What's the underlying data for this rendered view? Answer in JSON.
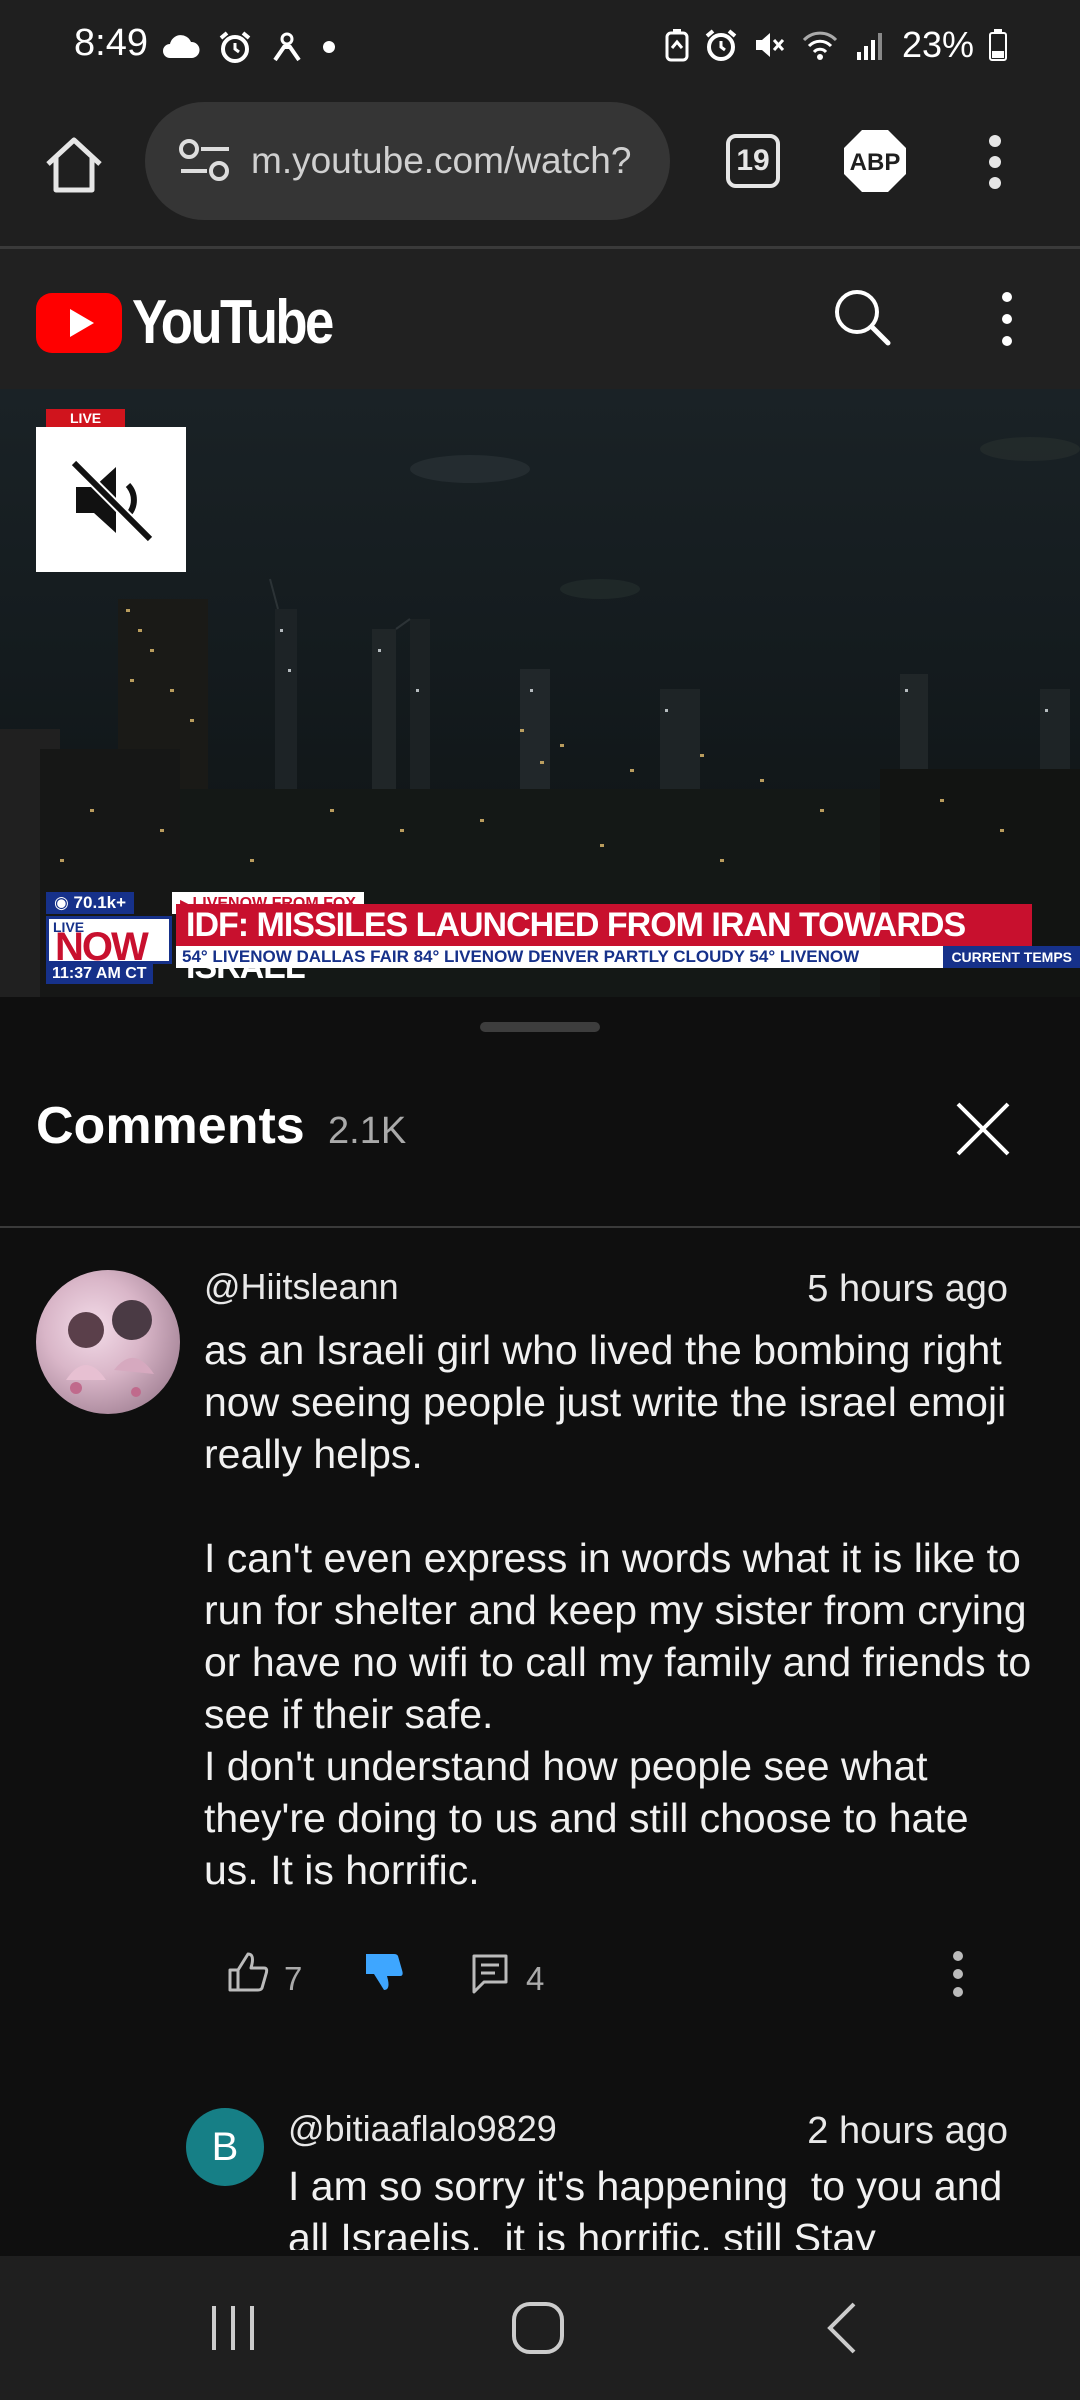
{
  "status_bar": {
    "time": "8:49",
    "battery": "23%"
  },
  "browser": {
    "url": "m.youtube.com/watch?",
    "tab_count": "19",
    "adblock_label": "ABP"
  },
  "youtube": {
    "logo_text": "YouTube"
  },
  "video": {
    "live_tag": "LIVE",
    "viewer_count": "◉ 70.1k+",
    "network": "▸ LIVENOW FROM FOX",
    "now_live": "LIVE",
    "now_word": "NOW",
    "headline": "IDF: MISSILES LAUNCHED FROM IRAN TOWARDS ISRAEL",
    "ticker": "54°   LIVENOW   DALLAS   FAIR  84°   LIVENOW   DENVER   PARTLY CLOUDY  54°   LIVENOW",
    "ticker_time": "11:37 AM CT",
    "current_temps": "CURRENT TEMPS"
  },
  "comments": {
    "title": "Comments",
    "count": "2.1K",
    "items": [
      {
        "author": "@Hiitsleann",
        "time": "5 hours ago",
        "text": "as an Israeli girl who lived the bombing right now seeing people just write the israel emoji really helps.\n\nI can't even express in words what it is like to run for shelter and keep my sister from crying or have no wifi to call my family and friends to see if their safe.\nI don't understand how people see what they're doing to us and still choose to hate us. It is horrific.",
        "likes": "7",
        "replies": "4"
      }
    ],
    "reply": {
      "avatar_letter": "B",
      "author": "@bitiaaflalo9829",
      "time": "2 hours ago",
      "text": "I am so sorry it's happening  to you and all Israelis,  it is horrific. still Stay"
    }
  },
  "colors": {
    "background": "#0f0f0f",
    "youtube_red": "#ff0000",
    "dislike_active": "#3ea6ff",
    "headline_red": "#c8102e",
    "reply_avatar": "#167f86"
  },
  "icons": [
    "cloud-icon",
    "alarm-icon",
    "home-icon",
    "tune-icon",
    "abp-icon",
    "more-vert-icon",
    "search-icon",
    "mute-icon",
    "close-icon",
    "thumb-up-icon",
    "thumb-down-icon",
    "reply-icon",
    "nav-recent-icon",
    "nav-home-icon",
    "nav-back-icon"
  ]
}
